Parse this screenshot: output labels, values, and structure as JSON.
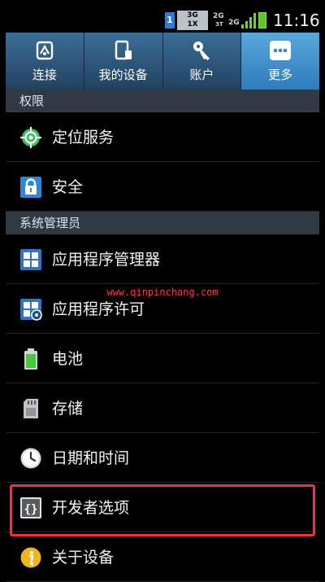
{
  "status_bar": {
    "sim_badge": "1",
    "net_badge_top": "3G",
    "net_badge_bottom": "1X",
    "net2_top": "2G",
    "net2_bottom": "3T",
    "net3": "2G",
    "time": "11:16",
    "battery_color": "#5cc62c"
  },
  "tabs": [
    {
      "label": "连接",
      "icon": "connection-icon"
    },
    {
      "label": "我的设备",
      "icon": "device-icon"
    },
    {
      "label": "账户",
      "icon": "key-icon"
    },
    {
      "label": "更多",
      "icon": "more-dots-icon",
      "active": true
    }
  ],
  "sections": [
    {
      "header": "权限",
      "items": [
        {
          "label": "定位服务",
          "icon": "location-icon"
        },
        {
          "label": "安全",
          "icon": "lock-icon"
        }
      ]
    },
    {
      "header": "系统管理员",
      "items": [
        {
          "label": "应用程序管理器",
          "icon": "app-grid-icon"
        },
        {
          "label": "应用程序许可",
          "icon": "app-permission-icon"
        },
        {
          "label": "电池",
          "icon": "battery-icon"
        },
        {
          "label": "存储",
          "icon": "sd-card-icon"
        },
        {
          "label": "日期和时间",
          "icon": "clock-icon"
        },
        {
          "label": "开发者选项",
          "icon": "braces-icon",
          "highlighted": true
        },
        {
          "label": "关于设备",
          "icon": "info-icon"
        }
      ]
    }
  ],
  "watermark": "www.qinpinchang.com",
  "colors": {
    "accent_tab": "#4b98d0",
    "highlight_border": "#e23a3a",
    "section_header_bg": "#2f3a44"
  }
}
